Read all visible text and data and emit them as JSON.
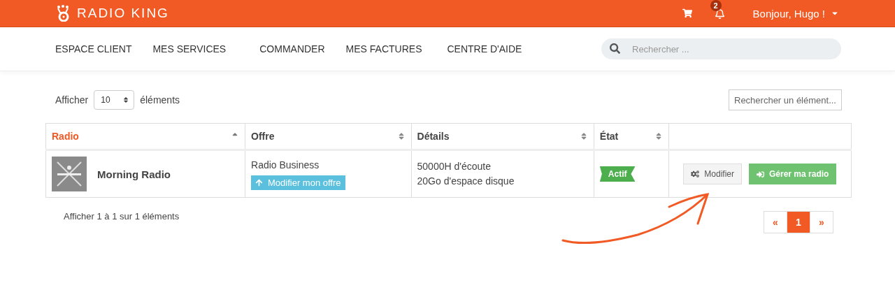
{
  "header": {
    "brand": "RADIO KING",
    "notifications": "2",
    "greeting": "Bonjour, Hugo !"
  },
  "nav": {
    "items": [
      "ESPACE CLIENT",
      "MES SERVICES",
      "COMMANDER",
      "MES FACTURES",
      "CENTRE D'AIDE"
    ],
    "search": {
      "placeholder": "Rechercher ..."
    }
  },
  "controls": {
    "show_label": "Afficher",
    "page_size": "10",
    "elements_label": "éléments",
    "filter": {
      "placeholder": "Rechercher un élément..."
    }
  },
  "table": {
    "columns": [
      {
        "label": "Radio",
        "sorted": true
      },
      {
        "label": "Offre",
        "sorted": false
      },
      {
        "label": "Détails",
        "sorted": false
      },
      {
        "label": "État",
        "sorted": false
      }
    ],
    "rows": [
      {
        "thumbnail": {
          "kind": "picture"
        },
        "name": "Morning Radio",
        "offer": "Radio Business",
        "upgrade": "Modifier mon offre",
        "details": [
          "50000H d'écoute",
          "20Go d'espace disque"
        ],
        "status": "Actif",
        "actions": [
          {
            "label": "Modifier",
            "primary": false
          },
          {
            "label": "Gérer ma radio",
            "primary": true
          }
        ]
      }
    ]
  },
  "info": "Afficher 1 à 1 sur 1 éléments",
  "pagination": [
    {
      "label": "«",
      "selected": false
    },
    {
      "label": "1",
      "selected": true
    },
    {
      "label": "»",
      "selected": false
    }
  ]
}
